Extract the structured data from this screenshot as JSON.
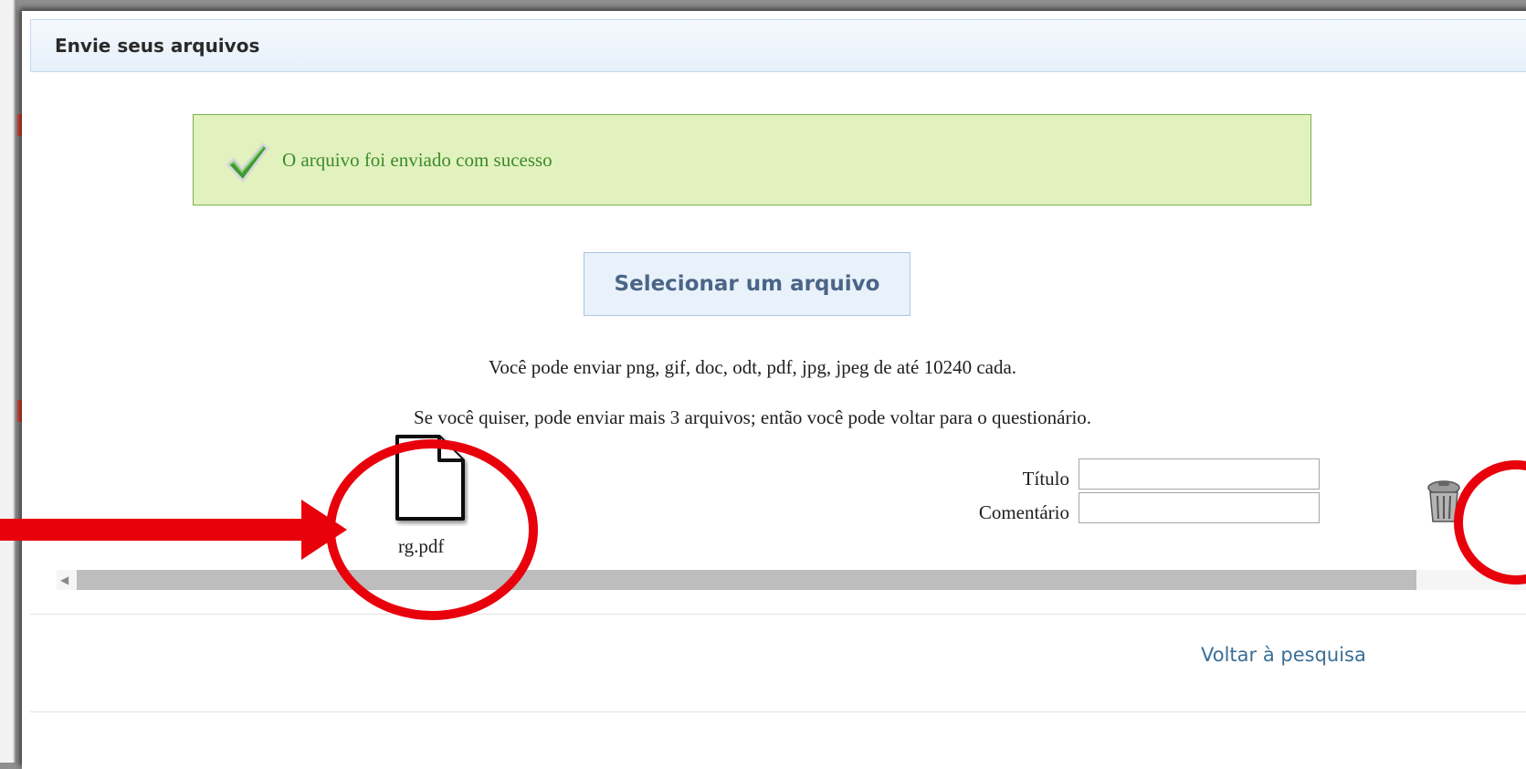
{
  "panel": {
    "title": "Envie seus arquivos"
  },
  "alert": {
    "message": "O arquivo foi enviado com sucesso",
    "icon": "checkmark-icon",
    "color": "#3c8b2a"
  },
  "upload": {
    "select_label": "Selecionar um arquivo",
    "allowed_text": "Você pode enviar png, gif, doc, odt, pdf, jpg, jpeg de até 10240 cada.",
    "remaining_text": "Se você quiser, pode enviar mais 3 arquivos; então você pode voltar para o questionário."
  },
  "file": {
    "name": "rg.pdf",
    "icon": "document-icon",
    "title_label": "Título",
    "title_value": "",
    "comment_label": "Comentário",
    "comment_value": "",
    "delete_icon": "trash-icon"
  },
  "footer": {
    "back_link": "Voltar à pesquisa"
  },
  "colors": {
    "annotation": "#e8000b",
    "header_bg": "#e6f0fa",
    "alert_bg": "#e2f2be",
    "link": "#3a6f96"
  }
}
